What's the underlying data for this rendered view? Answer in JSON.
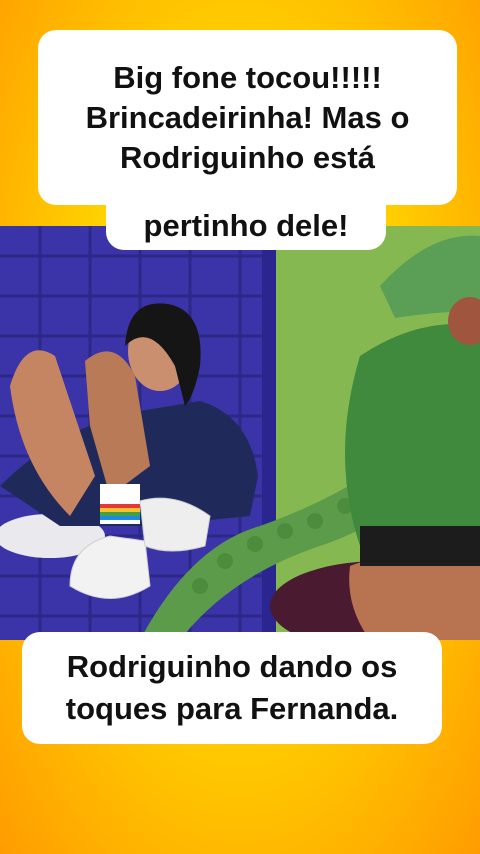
{
  "top_caption": {
    "lines_main": "Big fone tocou!!!!! Brincadeirinha! Mas o Rodriguinho está",
    "line_last": "pertinho dele!"
  },
  "bottom_caption": {
    "text": "Rodriguinho dando os toques para Fernanda."
  },
  "colors": {
    "background": "#ffd400",
    "caption_bg": "#ffffff",
    "caption_text": "#111111"
  }
}
